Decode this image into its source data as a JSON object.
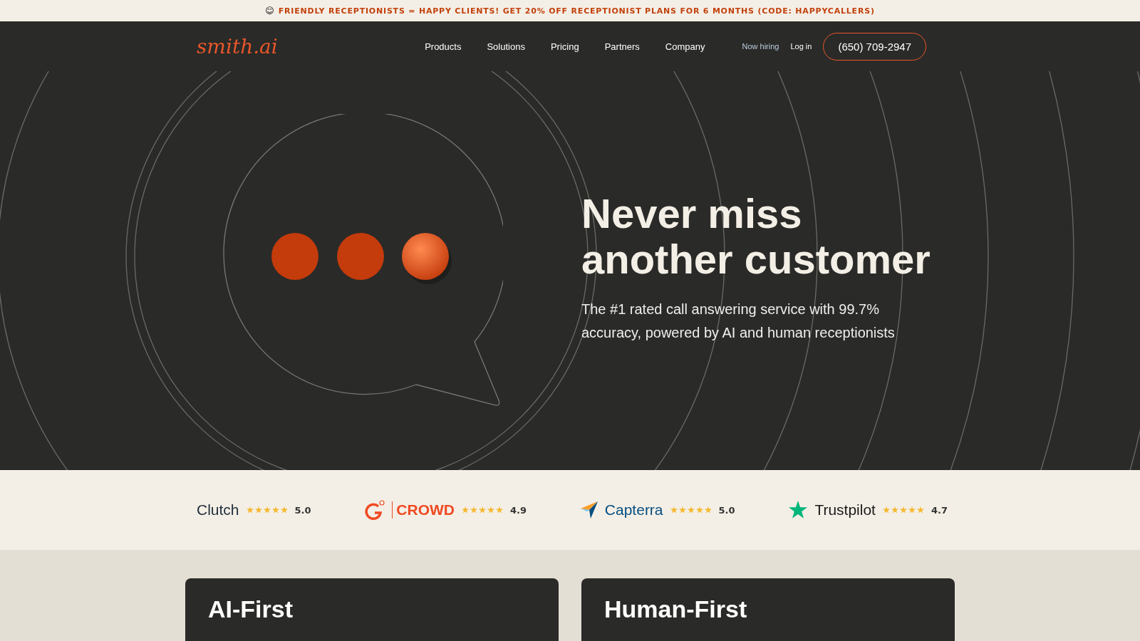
{
  "promo_banner": {
    "emoji": "😊",
    "text": "FRIENDLY RECEPTIONISTS = HAPPY CLIENTS! GET 20% OFF RECEPTIONIST PLANS FOR 6 MONTHS (CODE: HAPPYCALLERS)"
  },
  "nav": {
    "logo": "smith.ai",
    "items": [
      "Products",
      "Solutions",
      "Pricing",
      "Partners",
      "Company"
    ],
    "secondary_links": [
      "Now hiring",
      "Log in"
    ],
    "phone_button": "(650) 709-2947"
  },
  "hero": {
    "title": "Never miss another customer",
    "subtitle": "The #1 rated call answering service with 99.7% accuracy, powered by AI and human receptionists"
  },
  "ratings": [
    {
      "kind": "clutch",
      "name": "Clutch",
      "stars": 5,
      "score": "5.0"
    },
    {
      "kind": "g2",
      "name": "CROWD",
      "stars": 5,
      "score": "4.9"
    },
    {
      "kind": "capterra",
      "name": "Capterra",
      "stars": 5,
      "score": "5.0"
    },
    {
      "kind": "trustpilot",
      "name": "Trustpilot",
      "stars": 5,
      "score": "4.7"
    }
  ],
  "cards": [
    {
      "title": "AI-First"
    },
    {
      "title": "Human-First"
    }
  ]
}
